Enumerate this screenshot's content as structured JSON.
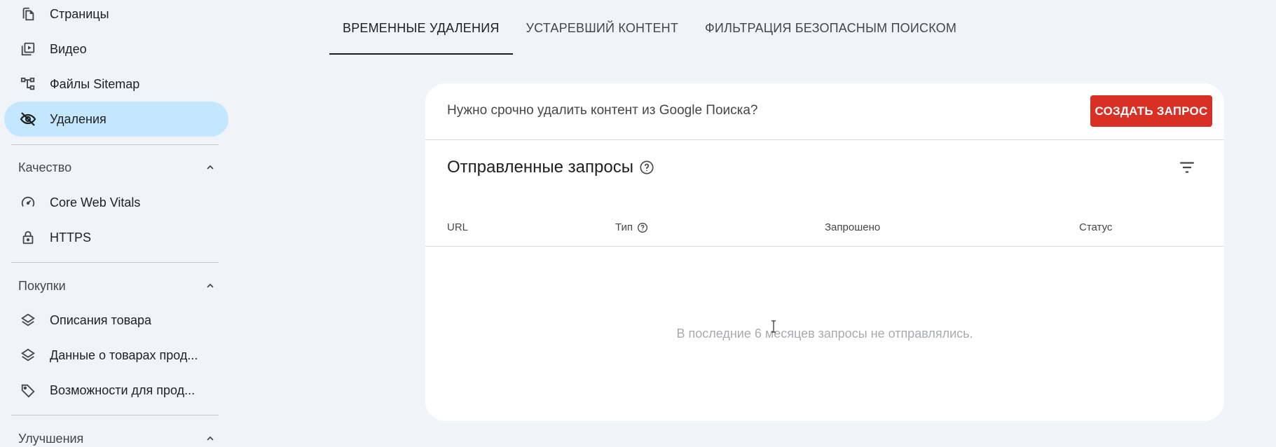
{
  "sidebar": {
    "items": [
      {
        "label": "Страницы",
        "icon": "pages-icon"
      },
      {
        "label": "Видео",
        "icon": "video-icon"
      },
      {
        "label": "Файлы Sitemap",
        "icon": "sitemap-icon"
      },
      {
        "label": "Удаления",
        "icon": "visibility-off-icon",
        "active": true
      }
    ],
    "sections": [
      {
        "title": "Качество",
        "items": [
          {
            "label": "Core Web Vitals",
            "icon": "speed-icon"
          },
          {
            "label": "HTTPS",
            "icon": "lock-icon"
          }
        ]
      },
      {
        "title": "Покупки",
        "items": [
          {
            "label": "Описания товара",
            "icon": "layers-icon"
          },
          {
            "label": "Данные о товарах прод...",
            "icon": "layers-icon"
          },
          {
            "label": "Возможности для прод...",
            "icon": "tag-icon"
          }
        ]
      },
      {
        "title": "Улучшения",
        "items": []
      }
    ]
  },
  "tabs": [
    {
      "label": "ВРЕМЕННЫЕ УДАЛЕНИЯ",
      "active": true
    },
    {
      "label": "УСТАРЕВШИЙ КОНТЕНТ",
      "active": false
    },
    {
      "label": "ФИЛЬТРАЦИЯ БЕЗОПАСНЫМ ПОИСКОМ",
      "active": false
    }
  ],
  "card": {
    "prompt": "Нужно срочно удалить контент из Google Поиска?",
    "create_button": "СОЗДАТЬ ЗАПРОС",
    "title": "Отправленные запросы",
    "columns": {
      "url": "URL",
      "type": "Тип",
      "requested": "Запрошено",
      "status": "Статус"
    },
    "empty_message": "В последние 6 месяцев запросы не отправлялись."
  },
  "colors": {
    "active_nav_bg": "#c2e7ff",
    "create_button_bg": "#d93025",
    "page_bg": "#f0f4f9"
  }
}
